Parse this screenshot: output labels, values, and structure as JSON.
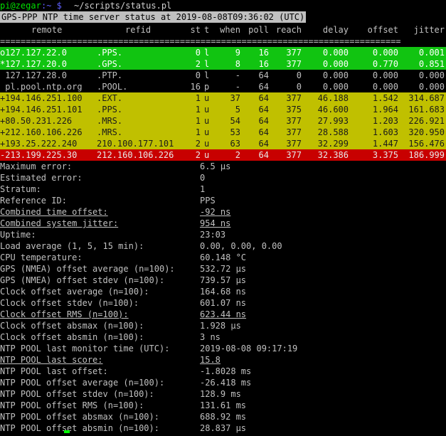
{
  "prompt": {
    "user": "pi@zegar",
    "sep": ":~ $ ",
    "command": "~/scripts/status.pl"
  },
  "title": "GPS-PPP NTP time server status at 2019-08-08T09:36:02 (UTC)",
  "headers": {
    "remote": "remote",
    "refid": "refid",
    "st": "st",
    "t": "t",
    "when": "when",
    "poll": "poll",
    "reach": "reach",
    "delay": "delay",
    "offset": "offset",
    "jitter": "jitter"
  },
  "separator": "==============================================================================",
  "peers": [
    {
      "remote": "o127.127.22.0",
      "refid": ".PPS.",
      "st": "0",
      "t": "l",
      "when": "9",
      "poll": "16",
      "reach": "377",
      "delay": "0.000",
      "offset": "0.000",
      "jitter": "0.001",
      "color": "green"
    },
    {
      "remote": "*127.127.20.0",
      "refid": ".GPS.",
      "st": "2",
      "t": "l",
      "when": "8",
      "poll": "16",
      "reach": "377",
      "delay": "0.000",
      "offset": "0.770",
      "jitter": "0.851",
      "color": "green"
    },
    {
      "remote": " 127.127.28.0",
      "refid": ".PTP.",
      "st": "0",
      "t": "l",
      "when": "-",
      "poll": "64",
      "reach": "0",
      "delay": "0.000",
      "offset": "0.000",
      "jitter": "0.000",
      "color": "black"
    },
    {
      "remote": " pl.pool.ntp.org",
      "refid": ".POOL.",
      "st": "16",
      "t": "p",
      "when": "-",
      "poll": "64",
      "reach": "0",
      "delay": "0.000",
      "offset": "0.000",
      "jitter": "0.000",
      "color": "black"
    },
    {
      "remote": "+194.146.251.100",
      "refid": ".EXT.",
      "st": "1",
      "t": "u",
      "when": "37",
      "poll": "64",
      "reach": "377",
      "delay": "46.188",
      "offset": "1.542",
      "jitter": "314.687",
      "color": "yellow"
    },
    {
      "remote": "+194.146.251.101",
      "refid": ".PPS.",
      "st": "1",
      "t": "u",
      "when": "5",
      "poll": "64",
      "reach": "375",
      "delay": "46.600",
      "offset": "1.964",
      "jitter": "161.683",
      "color": "yellow"
    },
    {
      "remote": "+80.50.231.226",
      "refid": ".MRS.",
      "st": "1",
      "t": "u",
      "when": "54",
      "poll": "64",
      "reach": "377",
      "delay": "27.993",
      "offset": "1.203",
      "jitter": "226.921",
      "color": "yellow"
    },
    {
      "remote": "+212.160.106.226",
      "refid": ".MRS.",
      "st": "1",
      "t": "u",
      "when": "53",
      "poll": "64",
      "reach": "377",
      "delay": "28.588",
      "offset": "1.603",
      "jitter": "320.950",
      "color": "yellow"
    },
    {
      "remote": "+193.25.222.240",
      "refid": "210.100.177.101",
      "st": "2",
      "t": "u",
      "when": "63",
      "poll": "64",
      "reach": "377",
      "delay": "32.299",
      "offset": "1.447",
      "jitter": "156.476",
      "color": "yellow"
    },
    {
      "remote": "-213.199.225.30",
      "refid": "212.160.106.226",
      "st": "2",
      "t": "u",
      "when": "2",
      "poll": "64",
      "reach": "377",
      "delay": "32.386",
      "offset": "3.375",
      "jitter": "186.999",
      "color": "red"
    }
  ],
  "stats": [
    {
      "label": "Maximum error:",
      "value": "6.5 µs",
      "u": false
    },
    {
      "label": "Estimated error:",
      "value": "0",
      "u": false
    },
    {
      "label": "Stratum:",
      "value": "1",
      "u": false
    },
    {
      "label": "Reference ID:",
      "value": "PPS",
      "u": false
    },
    {
      "label": "Combined time offset:",
      "value": "-92 ns",
      "u": true
    },
    {
      "label": "Combined system jitter:",
      "value": "954 ns",
      "u": true
    },
    {
      "label": "Uptime:",
      "value": "23:03",
      "u": false
    },
    {
      "label": "Load average (1, 5, 15 min):",
      "value": "0.00, 0.00, 0.00",
      "u": false
    },
    {
      "label": "CPU temperature:",
      "value": "60.148 °C",
      "u": false
    },
    {
      "label": "GPS (NMEA) offset average (n=100):",
      "value": "532.72 µs",
      "u": false
    },
    {
      "label": "GPS (NMEA) offset stdev (n=100):",
      "value": "739.57 µs",
      "u": false
    },
    {
      "label": "Clock offset average (n=100):",
      "value": "164.68 ns",
      "u": false
    },
    {
      "label": "Clock offset stdev (n=100):",
      "value": "601.07 ns",
      "u": false
    },
    {
      "label": "Clock offset RMS (n=100):",
      "value": "623.44 ns",
      "u": true
    },
    {
      "label": "Clock offset absmax (n=100):",
      "value": "1.928 µs",
      "u": false
    },
    {
      "label": "Clock offset absmin (n=100):",
      "value": "3 ns",
      "u": false
    },
    {
      "label": "NTP POOL last monitor time (UTC):",
      "value": "2019-08-08 09:17:19",
      "u": false
    },
    {
      "label": "NTP POOL last score:",
      "value": "15.8",
      "u": true
    },
    {
      "label": "NTP POOL last offset:",
      "value": "-1.8028 ms",
      "u": false
    },
    {
      "label": "NTP POOL offset average (n=100):",
      "value": "-26.418 ms",
      "u": false
    },
    {
      "label": "NTP POOL offset stdev (n=100):",
      "value": "128.9 ms",
      "u": false
    },
    {
      "label": "NTP POOL offset RMS (n=100):",
      "value": "131.61 ms",
      "u": false
    },
    {
      "label": "NTP POOL offset absmax (n=100):",
      "value": "688.92 ms",
      "u": false
    },
    {
      "label": "NTP POOL offset absmin (n=100):",
      "value": "28.837 µs",
      "u": false
    }
  ],
  "colors": {
    "green": "#11c411",
    "yellow": "#c0c000",
    "red": "#c80000",
    "prompt_user": "#00e000",
    "prompt_path": "#6060ff",
    "cursor": "#00ff00"
  }
}
